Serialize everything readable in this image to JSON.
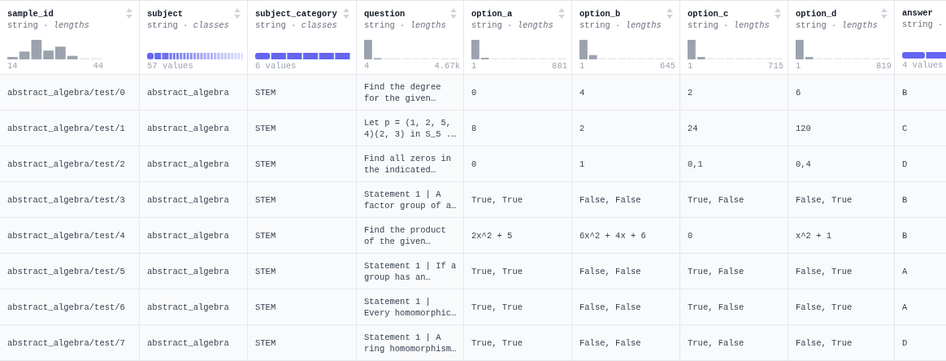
{
  "columns": [
    {
      "name": "sample_id",
      "subtitle": "string · *lengths*",
      "stats": {
        "kind": "histogram",
        "min": "14",
        "max": "44"
      }
    },
    {
      "name": "subject",
      "subtitle": "string · *classes*",
      "stats": {
        "kind": "classes",
        "count": "57 values"
      }
    },
    {
      "name": "subject_category",
      "subtitle": "string · *classes*",
      "stats": {
        "kind": "classes",
        "count": "6 values"
      }
    },
    {
      "name": "question",
      "subtitle": "string · *lengths*",
      "stats": {
        "kind": "histogram",
        "min": "4",
        "max": "4.67k"
      }
    },
    {
      "name": "option_a",
      "subtitle": "string · *lengths*",
      "stats": {
        "kind": "histogram",
        "min": "1",
        "max": "881"
      }
    },
    {
      "name": "option_b",
      "subtitle": "string · *lengths*",
      "stats": {
        "kind": "histogram",
        "min": "1",
        "max": "645"
      }
    },
    {
      "name": "option_c",
      "subtitle": "string · *lengths*",
      "stats": {
        "kind": "histogram",
        "min": "1",
        "max": "715"
      }
    },
    {
      "name": "option_d",
      "subtitle": "string · *lengths*",
      "stats": {
        "kind": "histogram",
        "min": "1",
        "max": "819"
      }
    },
    {
      "name": "answer",
      "subtitle": "string ·",
      "stats": {
        "kind": "classes",
        "count": "4 values"
      }
    }
  ],
  "rows": [
    [
      "abstract_algebra/test/0",
      "abstract_algebra",
      "STEM",
      "Find the degree for the given…",
      "0",
      "4",
      "2",
      "6",
      "B"
    ],
    [
      "abstract_algebra/test/1",
      "abstract_algebra",
      "STEM",
      "Let p = (1, 2, 5, 4)(2, 3) in S_5 .…",
      "8",
      "2",
      "24",
      "120",
      "C"
    ],
    [
      "abstract_algebra/test/2",
      "abstract_algebra",
      "STEM",
      "Find all zeros in the indicated…",
      "0",
      "1",
      "0,1",
      "0,4",
      "D"
    ],
    [
      "abstract_algebra/test/3",
      "abstract_algebra",
      "STEM",
      "Statement 1 | A factor group of a…",
      "True, True",
      "False, False",
      "True, False",
      "False, True",
      "B"
    ],
    [
      "abstract_algebra/test/4",
      "abstract_algebra",
      "STEM",
      "Find the product of the given…",
      "2x^2 + 5",
      "6x^2 + 4x + 6",
      "0",
      "x^2 + 1",
      "B"
    ],
    [
      "abstract_algebra/test/5",
      "abstract_algebra",
      "STEM",
      "Statement 1 | If a group has an…",
      "True, True",
      "False, False",
      "True, False",
      "False, True",
      "A"
    ],
    [
      "abstract_algebra/test/6",
      "abstract_algebra",
      "STEM",
      "Statement 1 | Every homomorphic…",
      "True, True",
      "False, False",
      "True, False",
      "False, True",
      "A"
    ],
    [
      "abstract_algebra/test/7",
      "abstract_algebra",
      "STEM",
      "Statement 1 | A ring homomorphism…",
      "True, True",
      "False, False",
      "True, False",
      "False, True",
      "D"
    ]
  ]
}
